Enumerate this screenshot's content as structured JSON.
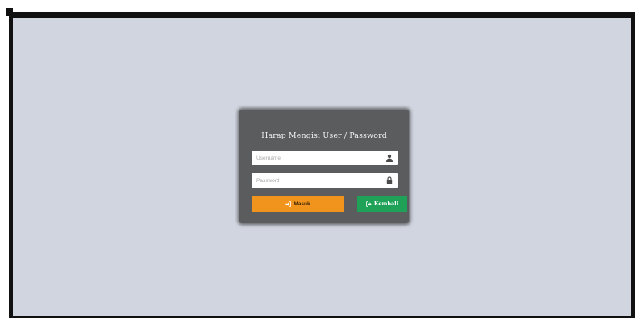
{
  "login": {
    "title": "Harap Mengisi User / Password",
    "username": {
      "placeholder": "Username",
      "value": "",
      "icon": "user-icon"
    },
    "password": {
      "placeholder": "Password",
      "value": "",
      "icon": "lock-icon"
    },
    "buttons": {
      "masuk_label": "Masuk",
      "masuk_icon": "sign-in-icon",
      "kembali_label": "Kembali",
      "kembali_icon": "sign-out-icon"
    }
  },
  "colors": {
    "page_bg": "#d1d5df",
    "frame_border": "#111111",
    "panel_bg": "#5b5c5e",
    "masuk_button": "#f0941e",
    "kembali_button": "#1fa258"
  }
}
